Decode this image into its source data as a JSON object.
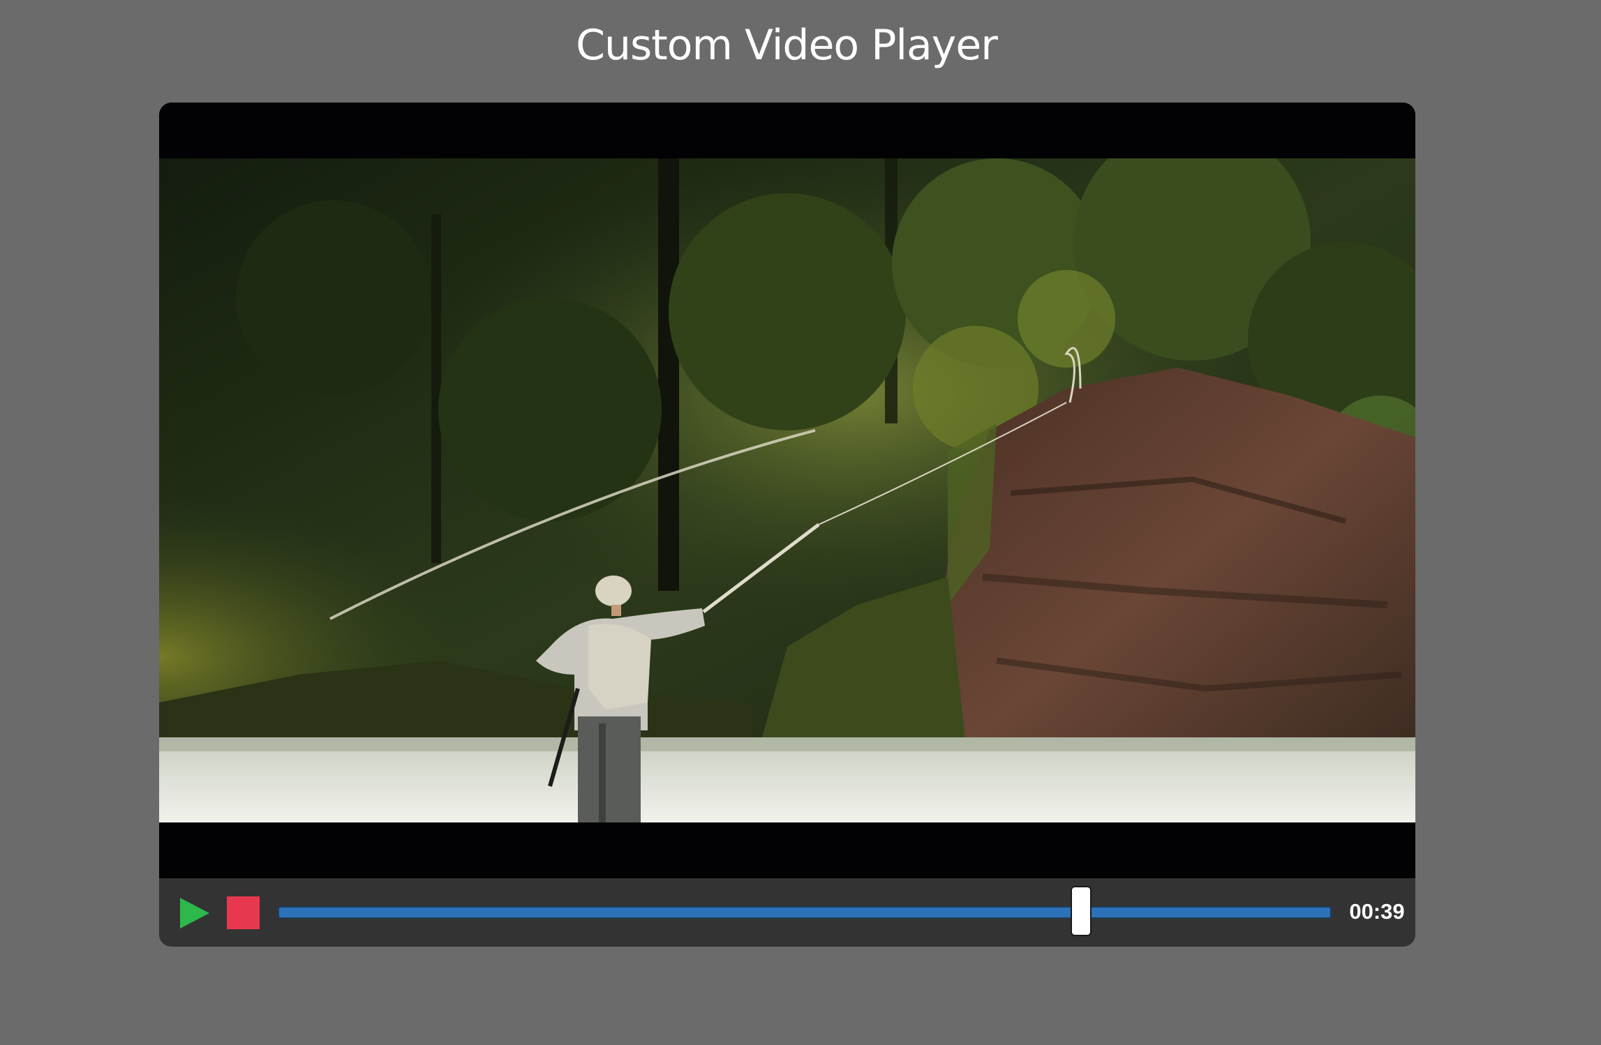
{
  "page": {
    "title": "Custom Video Player"
  },
  "player": {
    "progress_fraction": 0.762,
    "time_display": "00:39",
    "colors": {
      "play": "#2db84b",
      "stop": "#e8384f",
      "track": "#2b72b9",
      "controls_bg": "#333333"
    },
    "icons": {
      "play": "play-icon",
      "stop": "stop-icon"
    }
  }
}
